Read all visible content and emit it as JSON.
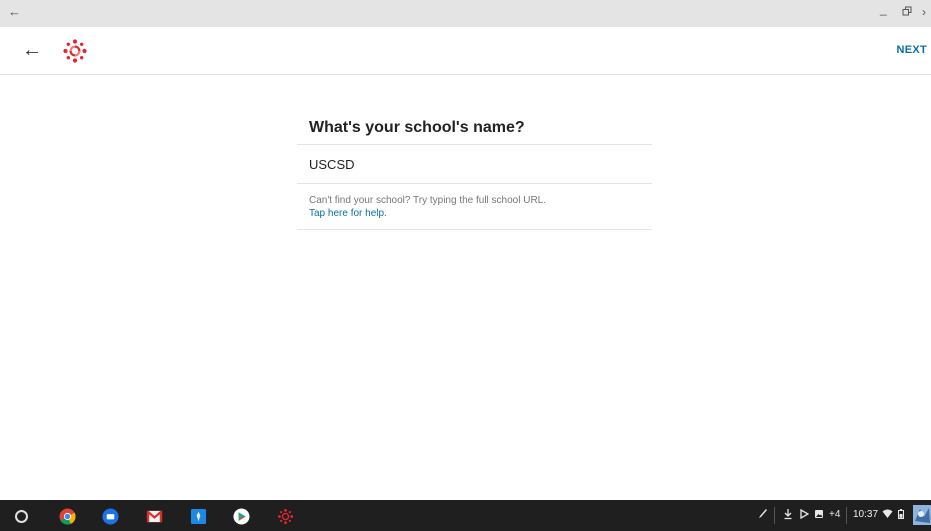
{
  "window": {
    "back_icon": "arrow-left-icon",
    "minimize_glyph": "_",
    "restore_glyph": "⧉",
    "close_glyph": "×"
  },
  "toolbar": {
    "next_label": "NEXT",
    "brand_color": "#e3262c",
    "link_color": "#0770a3"
  },
  "main": {
    "title": "What's your school's name?",
    "school_input_value": "USCSD",
    "hint_text": "Can't find your school? Try typing the full school URL.",
    "help_link": "Tap here for help."
  },
  "shelf": {
    "apps": [
      "chrome-icon",
      "files-icon",
      "gmail-icon",
      "keep-icon",
      "play-store-icon",
      "canvas-icon"
    ],
    "notification_count": "+4",
    "time": "10:37"
  }
}
